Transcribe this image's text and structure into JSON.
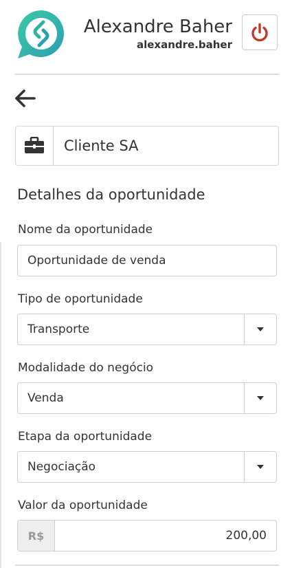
{
  "header": {
    "user_name": "Alexandre Baher",
    "user_login": "alexandre.baher",
    "logo_icon": "whatsapp-bubble-logo",
    "power_icon": "power-icon",
    "accent_color": "#2db5a0",
    "power_color": "#c0392b"
  },
  "nav": {
    "back_icon": "arrow-left-icon"
  },
  "client": {
    "icon": "briefcase-icon",
    "name": "Cliente SA"
  },
  "section": {
    "title": "Detalhes da oportunidade"
  },
  "form": {
    "name_label": "Nome da oportunidade",
    "name_value": "Oportunidade de venda",
    "type_label": "Tipo de oportunidade",
    "type_value": "Transporte",
    "modality_label": "Modalidade do negócio",
    "modality_value": "Venda",
    "stage_label": "Etapa da oportunidade",
    "stage_value": "Negociação",
    "amount_label": "Valor da oportunidade",
    "currency_prefix": "R$",
    "amount_value": "200,00"
  }
}
